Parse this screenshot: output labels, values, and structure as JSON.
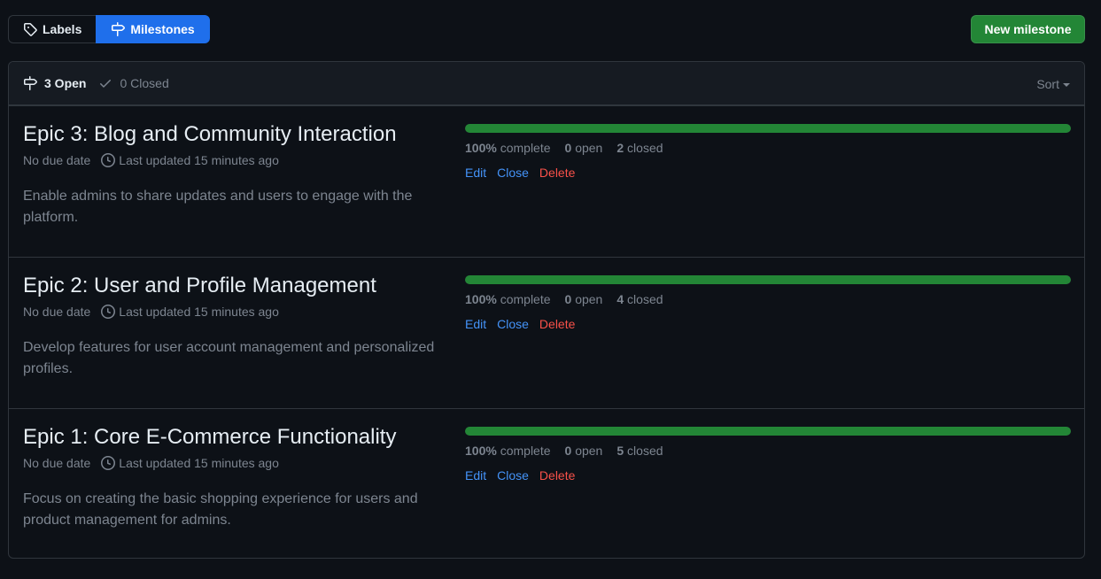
{
  "subnav": {
    "labels": "Labels",
    "milestones": "Milestones"
  },
  "new_milestone": "New milestone",
  "header": {
    "open": "3 Open",
    "closed": "0 Closed",
    "sort": "Sort"
  },
  "milestones": [
    {
      "title": "Epic 3: Blog and Community Interaction",
      "due": "No due date",
      "updated": "Last updated 15 minutes ago",
      "description": "Enable admins to share updates and users to engage with the platform.",
      "progress": 1.0,
      "percent": "100%",
      "complete": "complete",
      "open_count": "0",
      "open_label": "open",
      "closed_count": "2",
      "closed_label": "closed"
    },
    {
      "title": "Epic 2: User and Profile Management",
      "due": "No due date",
      "updated": "Last updated 15 minutes ago",
      "description": "Develop features for user account management and personalized profiles.",
      "progress": 1.0,
      "percent": "100%",
      "complete": "complete",
      "open_count": "0",
      "open_label": "open",
      "closed_count": "4",
      "closed_label": "closed"
    },
    {
      "title": "Epic 1: Core E-Commerce Functionality",
      "due": "No due date",
      "updated": "Last updated 15 minutes ago",
      "description": "Focus on creating the basic shopping experience for users and product management for admins.",
      "progress": 1.0,
      "percent": "100%",
      "complete": "complete",
      "open_count": "0",
      "open_label": "open",
      "closed_count": "5",
      "closed_label": "closed"
    }
  ],
  "actions": {
    "edit": "Edit",
    "close": "Close",
    "delete": "Delete"
  },
  "colors": {
    "background": "#0d1117",
    "accent_blue": "#1f6feb",
    "success_green": "#238636",
    "link_blue": "#4493f8",
    "danger_red": "#f85149"
  },
  "icons": {
    "labels": "tag-icon",
    "milestones": "milestone-icon",
    "open": "milestone-icon",
    "closed": "check-icon",
    "updated": "clock-icon"
  }
}
